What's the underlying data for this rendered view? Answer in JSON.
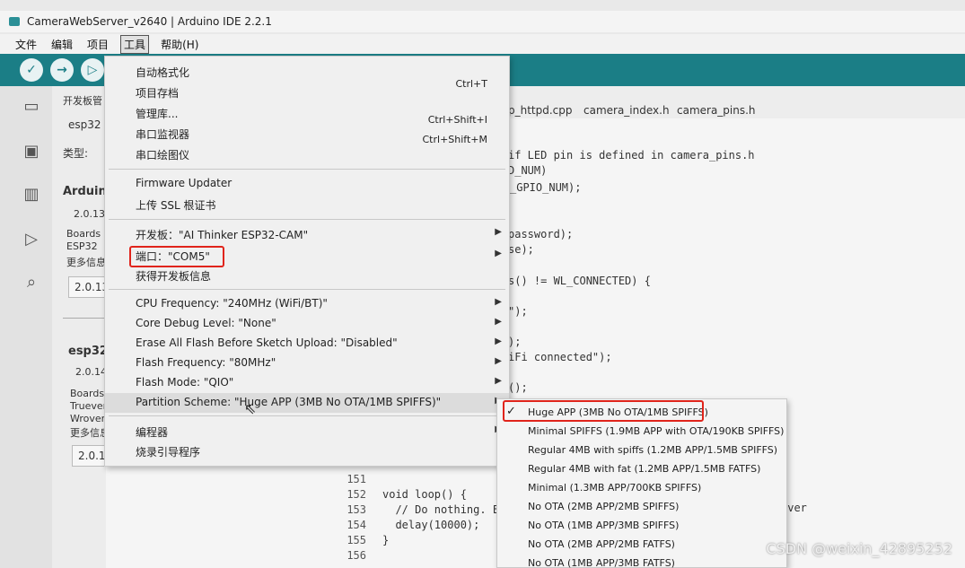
{
  "window": {
    "title": "CameraWebServer_v2640 | Arduino IDE 2.2.1"
  },
  "menubar": [
    "文件",
    "编辑",
    "项目",
    "工具",
    "帮助(H)"
  ],
  "toolbar": {
    "verify": "✓",
    "upload": "→",
    "debug": "▷"
  },
  "panel": {
    "title": "开发板管",
    "filter_value": "esp32",
    "type_label": "类型:",
    "item1_name": "Arduin",
    "item1_ver": "2.0.13",
    "item1_desc1": "Boards i",
    "item1_desc2": "ESP32",
    "item1_more": "更多信息",
    "item1_select": "2.0.13",
    "item2_name": "esp32",
    "item2_ver": "2.0.14",
    "item2_desc1": "Boards i",
    "item2_desc2": "Trueveri",
    "item2_desc3": "Wrover",
    "item2_more": "更多信息",
    "item2_select": "2.0.14"
  },
  "tabs": [
    "p_httpd.cpp",
    "camera_index.h",
    "camera_pins.h"
  ],
  "code_fragments": [
    "if LED pin is defined in camera_pins.h",
    "D_NUM)",
    "_GPIO_NUM);",
    "password);",
    "se);",
    "s() != WL_CONNECTED) {",
    "\");",
    ");",
    "iFi connected\");",
    "();",
    "rver"
  ],
  "code_lines": [
    {
      "n": "151",
      "text": ""
    },
    {
      "n": "152",
      "text": "void loop() {"
    },
    {
      "n": "153",
      "text": "  // Do nothing. E"
    },
    {
      "n": "154",
      "text": "  delay(10000);"
    },
    {
      "n": "155",
      "text": "}"
    },
    {
      "n": "156",
      "text": ""
    }
  ],
  "tools_menu": {
    "auto_format": "自动格式化",
    "auto_format_sc": "Ctrl+T",
    "archive": "项目存档",
    "library": "管理库...",
    "library_sc": "Ctrl+Shift+I",
    "serial_monitor": "串口监视器",
    "serial_monitor_sc": "Ctrl+Shift+M",
    "serial_plotter": "串口绘图仪",
    "firmware_updater": "Firmware Updater",
    "ssl": "上传 SSL 根证书",
    "board": "开发板：\"AI Thinker ESP32-CAM\"",
    "port": "端口：\"COM5\"",
    "board_info": "获得开发板信息",
    "cpu_freq": "CPU Frequency: \"240MHz (WiFi/BT)\"",
    "core_debug": "Core Debug Level: \"None\"",
    "erase_flash": "Erase All Flash Before Sketch Upload: \"Disabled\"",
    "flash_freq": "Flash Frequency: \"80MHz\"",
    "flash_mode": "Flash Mode: \"QIO\"",
    "partition": "Partition Scheme: \"Huge APP (3MB No OTA/1MB SPIFFS)\"",
    "programmer": "编程器",
    "burn_bootloader": "烧录引导程序"
  },
  "partition_submenu": {
    "checked": "✓",
    "items": [
      "Huge APP (3MB No OTA/1MB SPIFFS)",
      "Minimal SPIFFS (1.9MB APP with OTA/190KB SPIFFS)",
      "Regular 4MB with spiffs (1.2MB APP/1.5MB SPIFFS)",
      "Regular 4MB with fat (1.2MB APP/1.5MB FATFS)",
      "Minimal (1.3MB APP/700KB SPIFFS)",
      "No OTA (2MB APP/2MB SPIFFS)",
      "No OTA (1MB APP/3MB SPIFFS)",
      "No OTA (2MB APP/2MB FATFS)",
      "No OTA (1MB APP/3MB FATFS)"
    ]
  },
  "watermark": "CSDN @weixin_42895252",
  "colors": {
    "toolbar": "#1b7e86",
    "highlight_box": "#e0241b"
  }
}
